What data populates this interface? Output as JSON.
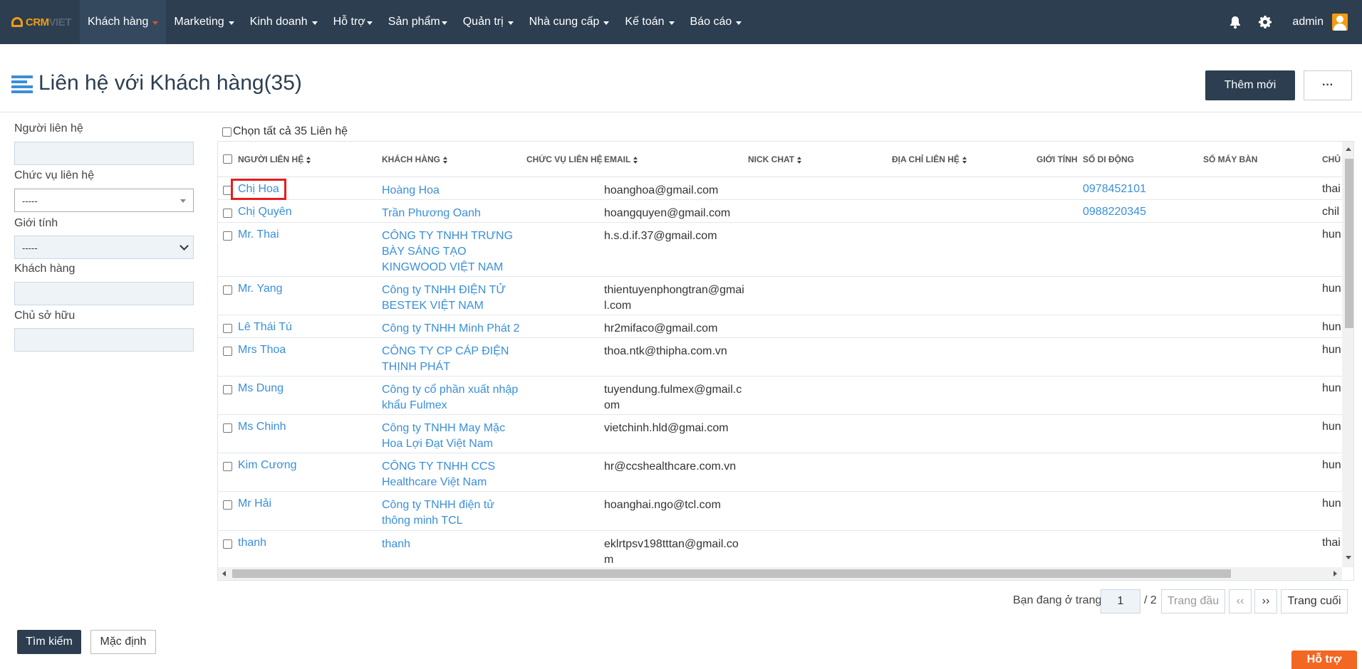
{
  "brand": {
    "logo_crm": "CRM",
    "logo_viet": "VIET"
  },
  "nav": [
    {
      "label": "Khách hàng",
      "active": true
    },
    {
      "label": "Marketing"
    },
    {
      "label": "Kinh doanh"
    },
    {
      "label": "Hỗ trợ"
    },
    {
      "label": "Sản phẩm"
    },
    {
      "label": "Quản trị"
    },
    {
      "label": "Nhà cung cấp"
    },
    {
      "label": "Kế toán"
    },
    {
      "label": "Báo cáo"
    }
  ],
  "user": {
    "name": "admin"
  },
  "page": {
    "title": "Liên hệ với Khách hàng(35)",
    "add_label": "Thêm mới",
    "more_label": "···"
  },
  "filters": {
    "contact_label": "Người liên hệ",
    "position_label": "Chức vụ liên hệ",
    "position_value": "-----",
    "gender_label": "Giới tính",
    "gender_value": "-----",
    "customer_label": "Khách hàng",
    "owner_label": "Chủ sở hữu"
  },
  "grid": {
    "select_all_label": "Chọn tất cả 35 Liên hệ",
    "columns": [
      "NGƯỜI LIÊN HỆ",
      "KHÁCH HÀNG",
      "CHỨC VỤ LIÊN HỆ",
      "EMAIL",
      "NICK CHAT",
      "ĐỊA CHỈ LIÊN HỆ",
      "GIỚI TÍNH",
      "SỐ DI ĐỘNG",
      "SỐ MÁY BÀN",
      "CHỦ"
    ],
    "rows": [
      {
        "name": "Chị Hoa",
        "customer": "Hoàng Hoa",
        "email": "hoanghoa@gmail.com",
        "mobile": "0978452101",
        "owner": "thai"
      },
      {
        "name": "Chị Quyên",
        "customer": "Trần Phương Oanh",
        "email": "hoangquyen@gmail.com",
        "mobile": "0988220345",
        "owner": "chil"
      },
      {
        "name": "Mr. Thai",
        "customer": "CÔNG TY TNHH TRƯNG BÀY SÁNG TẠO KINGWOOD VIỆT NAM",
        "email": "h.s.d.if.37@gmail.com",
        "mobile": "",
        "owner": "hun"
      },
      {
        "name": "Mr. Yang",
        "customer": "Công ty TNHH ĐIỆN TỬ BESTEK VIỆT NAM",
        "email": "thientuyenphongtran@gmail.com",
        "mobile": "",
        "owner": "hun"
      },
      {
        "name": "Lê Thái Tú",
        "customer": "Công ty TNHH Minh Phát 2",
        "email": "hr2mifaco@gmail.com",
        "mobile": "",
        "owner": "hun"
      },
      {
        "name": "Mrs Thoa",
        "customer": "CÔNG TY CP CÁP ĐIỆN THỊNH PHÁT",
        "email": "thoa.ntk@thipha.com.vn",
        "mobile": "",
        "owner": "hun"
      },
      {
        "name": "Ms Dung",
        "customer": "Công ty cổ phần xuất nhập khẩu Fulmex",
        "email": "tuyendung.fulmex@gmail.com",
        "mobile": "",
        "owner": "hun"
      },
      {
        "name": "Ms Chinh",
        "customer": "Công ty TNHH May Mặc Hoa Lợi Đạt Việt Nam",
        "email": "vietchinh.hld@gmai.com",
        "mobile": "",
        "owner": "hun"
      },
      {
        "name": "Kim Cương",
        "customer": "CÔNG TY TNHH CCS Healthcare Việt Nam",
        "email": "hr@ccshealthcare.com.vn",
        "mobile": "",
        "owner": "hun"
      },
      {
        "name": "Mr Hải",
        "customer": "Công ty TNHH điện tử thông minh TCL",
        "email": "hoanghai.ngo@tcl.com",
        "mobile": "",
        "owner": "hun"
      },
      {
        "name": "thanh",
        "customer": "thanh",
        "email": "eklrtpsv198tttan@gmail.com",
        "mobile": "",
        "owner": "thai"
      }
    ]
  },
  "pagination": {
    "prefix": "Bạn đang ở trang",
    "current": "1",
    "total": "/ 2",
    "first": "Trang đầu",
    "prev": "‹‹",
    "next": "››",
    "last": "Trang cuối"
  },
  "actions": {
    "search": "Tìm kiếm",
    "reset": "Mặc định"
  },
  "help": {
    "label": "Hỗ trợ"
  }
}
